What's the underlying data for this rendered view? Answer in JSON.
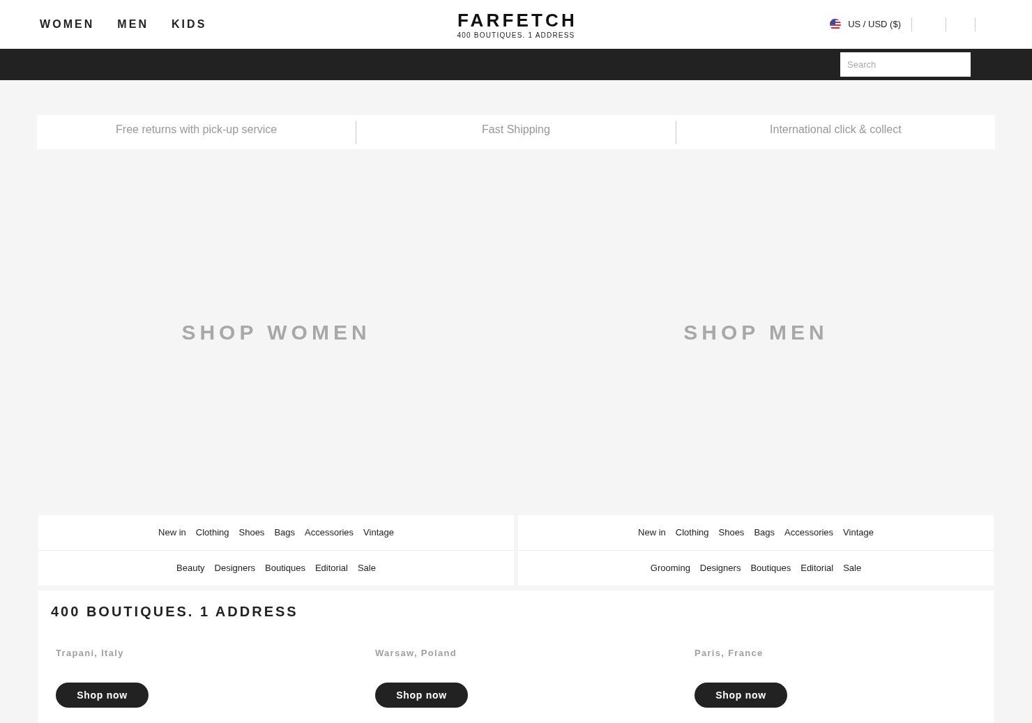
{
  "header": {
    "nav": [
      {
        "label": "WOMEN"
      },
      {
        "label": "MEN"
      },
      {
        "label": "KIDS"
      }
    ],
    "logo": {
      "wordmark": "FARFETCH",
      "tagline": "400 BOUTIQUES. 1 ADDRESS"
    },
    "locale": "US / USD ($)"
  },
  "search": {
    "placeholder": "Search"
  },
  "usp_bar": [
    "Free returns with pick-up service",
    "Fast Shipping",
    "International click & collect"
  ],
  "heroes": [
    {
      "label": "SHOP WOMEN",
      "link_rows": [
        [
          "New in",
          "Clothing",
          "Shoes",
          "Bags",
          "Accessories",
          "Vintage"
        ],
        [
          "Beauty",
          "Designers",
          "Boutiques",
          "Editorial",
          "Sale"
        ]
      ]
    },
    {
      "label": "SHOP MEN",
      "link_rows": [
        [
          "New in",
          "Clothing",
          "Shoes",
          "Bags",
          "Accessories",
          "Vintage"
        ],
        [
          "Grooming",
          "Designers",
          "Boutiques",
          "Editorial",
          "Sale"
        ]
      ]
    }
  ],
  "boutiques": {
    "title": "400 BOUTIQUES. 1 ADDRESS",
    "cities": [
      {
        "name": "Trapani, Italy",
        "button": "Shop now"
      },
      {
        "name": "Warsaw, Poland",
        "button": "Shop now"
      },
      {
        "name": "Paris, France",
        "button": "Shop now"
      }
    ]
  }
}
